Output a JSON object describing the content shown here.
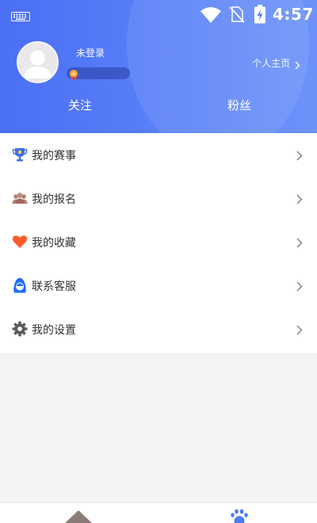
{
  "status_bar": {
    "time": "4:57",
    "icons": [
      "keyboard-icon",
      "wifi-icon",
      "no-sim-icon",
      "battery-charging-icon"
    ]
  },
  "profile": {
    "username": "未登录",
    "profile_link": "个人主页",
    "follow_label": "关注",
    "fans_label": "粉丝"
  },
  "menu": {
    "items": [
      {
        "label": "我的赛事",
        "icon": "trophy-icon",
        "color": "#3f6ee8"
      },
      {
        "label": "我的报名",
        "icon": "group-icon",
        "color": "#b07f72"
      },
      {
        "label": "我的收藏",
        "icon": "heart-icon",
        "color": "#ff5a2a"
      },
      {
        "label": "联系客服",
        "icon": "customer-service-icon",
        "color": "#1f6bff"
      },
      {
        "label": "我的设置",
        "icon": "gear-icon",
        "color": "#5d5d5d"
      }
    ]
  },
  "bottom_nav": {
    "items": [
      {
        "icon": "home-icon",
        "color": "#8a7a78"
      },
      {
        "icon": "footprint-icon",
        "color": "#4a7cf4"
      }
    ]
  },
  "colors": {
    "header_gradient_start": "#4b6ff6",
    "header_gradient_end": "#6d93fa",
    "menu_text": "#333333",
    "background": "#f2f3f5"
  }
}
